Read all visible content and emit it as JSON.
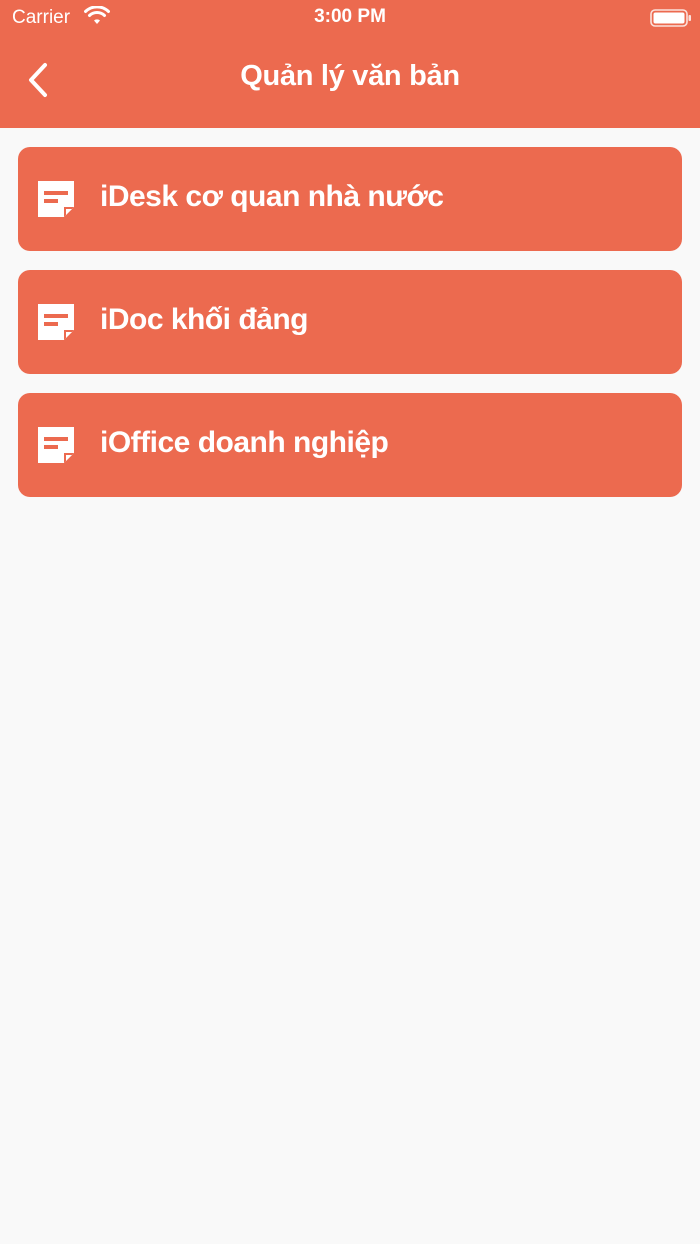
{
  "status_bar": {
    "carrier": "Carrier",
    "time": "3:00 PM"
  },
  "nav": {
    "title": "Quản lý văn bản",
    "back_icon": "chevron-left-icon"
  },
  "menu": {
    "items": [
      {
        "label": "iDesk cơ quan nhà nước",
        "icon": "document-icon"
      },
      {
        "label": "iDoc khối đảng",
        "icon": "document-icon"
      },
      {
        "label": "iOffice doanh nghiệp",
        "icon": "document-icon"
      }
    ]
  },
  "colors": {
    "primary": "#ec6a4f",
    "background": "#f9f9f9",
    "text_on_primary": "#ffffff"
  }
}
